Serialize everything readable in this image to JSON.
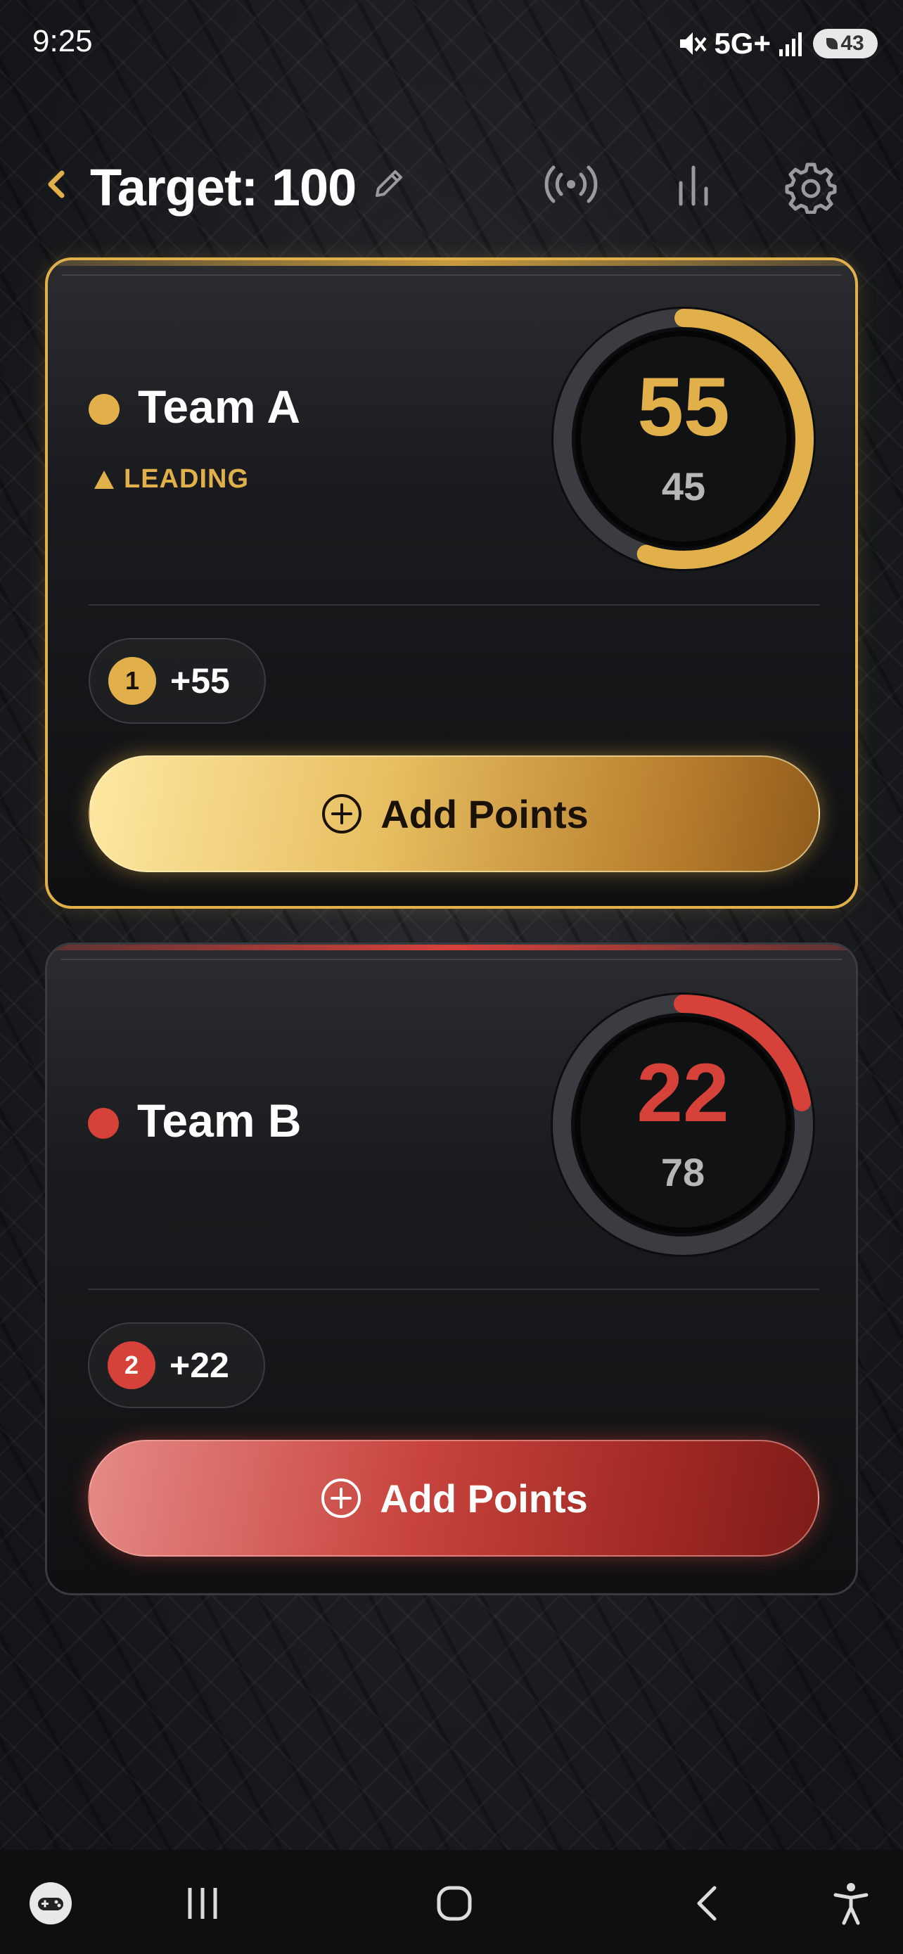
{
  "status_bar": {
    "time": "9:25",
    "network": "5G+",
    "battery": "43"
  },
  "header": {
    "title": "Target: 100"
  },
  "teams": [
    {
      "name": "Team A",
      "status": "LEADING",
      "score": "55",
      "remaining": "45",
      "progress": 0.55,
      "round_number": "1",
      "round_points": "+55",
      "button_label": "Add Points",
      "color": "#e2b04a"
    },
    {
      "name": "Team B",
      "score": "22",
      "remaining": "78",
      "progress": 0.22,
      "round_number": "2",
      "round_points": "+22",
      "button_label": "Add Points",
      "color": "#d6423a"
    }
  ]
}
